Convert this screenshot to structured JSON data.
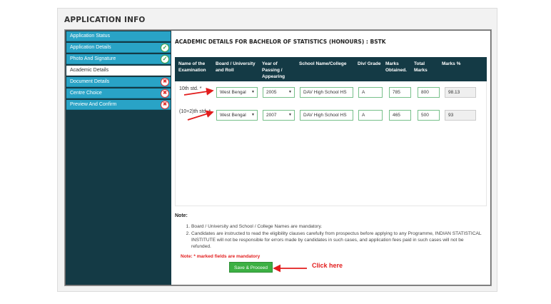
{
  "panel_title": "APPLICATION INFO",
  "sidebar": {
    "items": [
      {
        "label": "Application Status",
        "status": "none"
      },
      {
        "label": "Application Details",
        "status": "done"
      },
      {
        "label": "Photo And Signature",
        "status": "done"
      },
      {
        "label": "Academic Details",
        "status": "active"
      },
      {
        "label": "Document Details",
        "status": "incomplete"
      },
      {
        "label": "Centre Choice",
        "status": "incomplete"
      },
      {
        "label": "Preview And Confirm",
        "status": "incomplete"
      }
    ]
  },
  "main": {
    "heading": "ACADEMIC DETAILS FOR BACHELOR OF STATISTICS (HONOURS) : BSTK",
    "columns": [
      "Name of the Examination",
      "Board / University and Roll",
      "Year of Passing / Appearing",
      "School Name/College",
      "Div/ Grade",
      "Marks Obtained.",
      "Total Marks",
      "Marks %"
    ],
    "rows": [
      {
        "exam": "10th std. *",
        "board": "West Bengal",
        "year": "2005",
        "school": "DAV High School HS",
        "grade": "A",
        "obtained": "785",
        "total": "800",
        "percent": "98.13"
      },
      {
        "exam": "(10+2)th std. *",
        "board": "West Bengal",
        "year": "2007",
        "school": "DAV High School HS",
        "grade": "A",
        "obtained": "465",
        "total": "500",
        "percent": "93"
      }
    ]
  },
  "notes": {
    "title": "Note:",
    "items": [
      "Board / University and School / College Names are mandatory.",
      "Candidates are instructed to read the eligibility clauses carefully from prospectus before applying to any Programme, INDIAN STATISTICAL INSTITUTE will not be responsible for errors made by candidates in such cases, and application fees paid in such cases will not be refunded."
    ],
    "mandatory": "Note: * marked fields are mandatory"
  },
  "save_button": "Save & Proceed",
  "annotation": "Click here",
  "colors": {
    "sidebar_bg": "#143a45",
    "sidebar_item": "#29a3c6",
    "button": "#3cb043",
    "annotation": "#e21d1d"
  }
}
